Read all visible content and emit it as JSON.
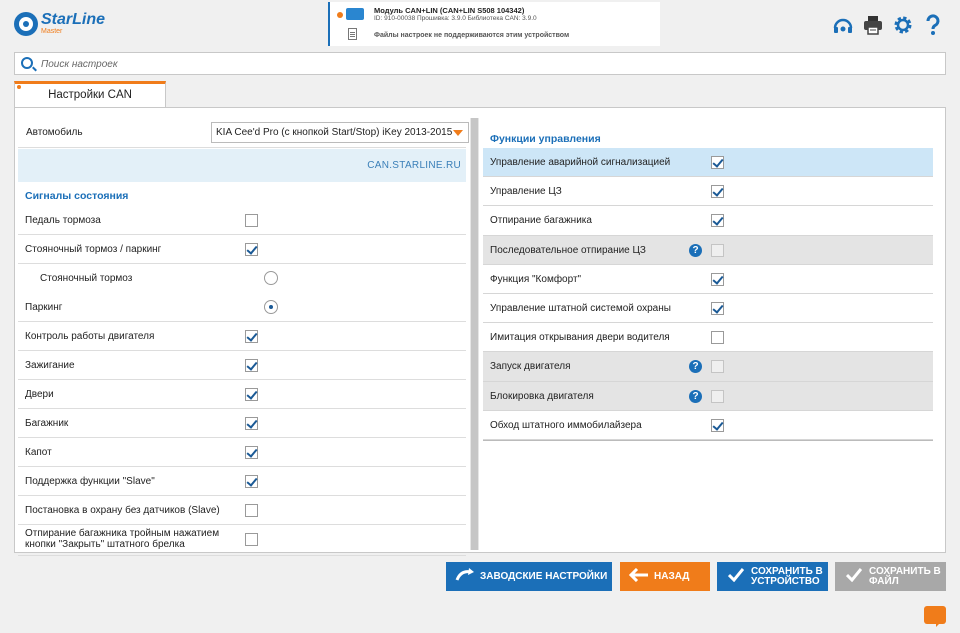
{
  "header": {
    "logo_name": "StarLine",
    "logo_sub": "Master",
    "device_title": "Модуль CAN+LIN (CAN+LIN S508 104342)",
    "device_info": "ID: 910-00038   Прошивка: 3.9.0   Библиотека CAN: 3.9.0",
    "device_note": "Файлы настроек не поддерживаются этим устройством",
    "icons": [
      "support-icon",
      "print-icon",
      "settings-gear-icon",
      "help-icon"
    ]
  },
  "search": {
    "placeholder": "Поиск настроек",
    "value": ""
  },
  "tab": {
    "label": "Настройки CAN"
  },
  "left": {
    "car_label": "Автомобиль",
    "car_value": "KIA Cee'd Pro (с кнопкой Start/Stop) iKey 2013-2015",
    "link": "CAN.STARLINE.RU",
    "section_title": "Сигналы состояния",
    "rows": [
      {
        "label": "Педаль тормоза",
        "checked": false
      },
      {
        "label": "Стояночный тормоз / паркинг",
        "checked": true
      },
      {
        "label": "Стояночный тормоз",
        "radio": false
      },
      {
        "label": "Паркинг",
        "radio": true
      },
      {
        "label": "Контроль работы двигателя",
        "checked": true
      },
      {
        "label": "Зажигание",
        "checked": true
      },
      {
        "label": "Двери",
        "checked": true
      },
      {
        "label": "Багажник",
        "checked": true
      },
      {
        "label": "Капот",
        "checked": true
      },
      {
        "label": "Поддержка функции \"Slave\"",
        "checked": true
      },
      {
        "label": "Постановка в охрану без датчиков (Slave)",
        "checked": false
      },
      {
        "label": "Отпирание багажника тройным нажатием кнопки \"Закрыть\" штатного брелка",
        "checked": false
      }
    ]
  },
  "right": {
    "section_title": "Функции управления",
    "rows": [
      {
        "label": "Управление аварийной сигнализацией",
        "checked": true,
        "highlighted": true
      },
      {
        "label": "Управление ЦЗ",
        "checked": true
      },
      {
        "label": "Отпирание багажника",
        "checked": true
      },
      {
        "label": "Последовательное отпирание ЦЗ",
        "checked": false,
        "disabled": true,
        "help": true
      },
      {
        "label": "Функция \"Комфорт\"",
        "checked": true
      },
      {
        "label": "Управление штатной системой охраны",
        "checked": true
      },
      {
        "label": "Имитация открывания двери водителя",
        "checked": false
      },
      {
        "label": "Запуск двигателя",
        "checked": false,
        "disabled": true,
        "help": true
      },
      {
        "label": "Блокировка двигателя",
        "checked": false,
        "disabled": true,
        "help": true
      },
      {
        "label": "Обход штатного иммобилайзера",
        "checked": true
      }
    ],
    "help_glyph": "?"
  },
  "buttons": {
    "factory": "ЗАВОДСКИЕ НАСТРОЙКИ",
    "back": "НАЗАД",
    "save_device_1": "СОХРАНИТЬ В",
    "save_device_2": "УСТРОЙСТВО",
    "save_file_1": "СОХРАНИТЬ В",
    "save_file_2": "ФАЙЛ"
  },
  "colors": {
    "accent": "#1b6fb8",
    "orange": "#f07c1a",
    "disabled": "#a8a8a8"
  }
}
